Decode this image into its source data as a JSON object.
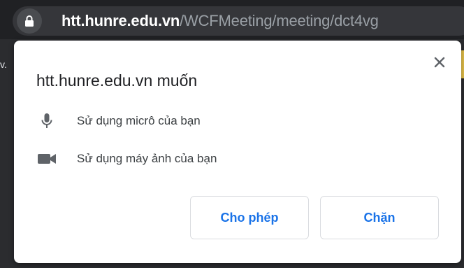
{
  "addressbar": {
    "url_host": "htt.hunre.edu.vn",
    "url_path": "/WCFMeeting/meeting/dct4vg",
    "lock_icon": "lock-icon"
  },
  "background": {
    "fragment": "v."
  },
  "popup": {
    "title": "htt.hunre.edu.vn muốn",
    "close_icon": "close-icon",
    "permissions": [
      {
        "icon": "microphone-icon",
        "label": "Sử dụng micrô của bạn"
      },
      {
        "icon": "camera-icon",
        "label": "Sử dụng máy ảnh của bạn"
      }
    ],
    "allow_label": "Cho phép",
    "block_label": "Chặn",
    "accent_color": "#1a73e8"
  }
}
